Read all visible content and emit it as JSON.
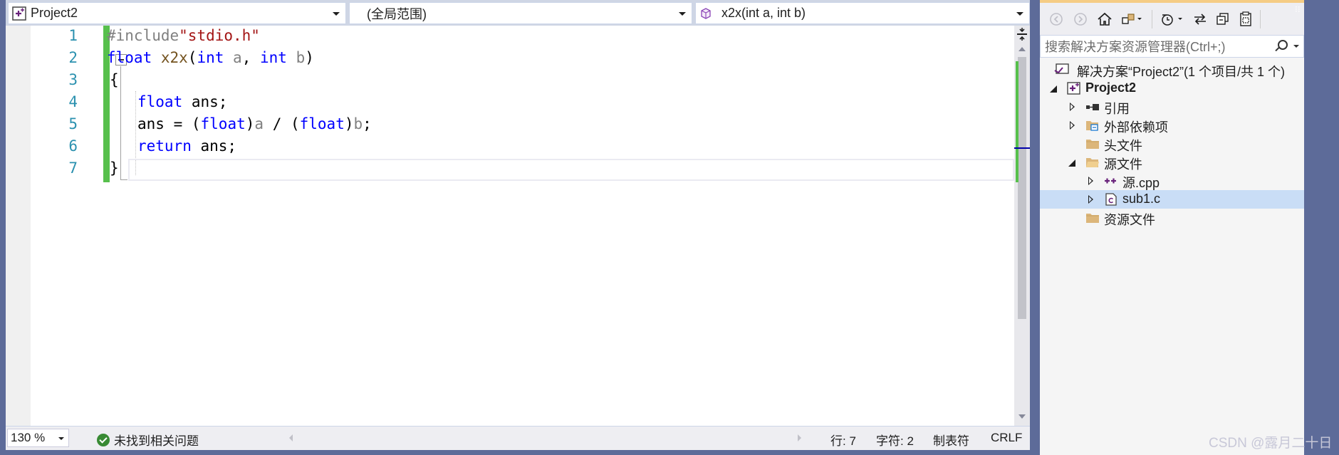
{
  "nav": {
    "project": "Project2",
    "scope": "(全局范围)",
    "member": "x2x(int a, int b)"
  },
  "editor": {
    "line_numbers": [
      "1",
      "2",
      "3",
      "4",
      "5",
      "6",
      "7"
    ],
    "lines": {
      "l1_pp": "#include",
      "l1_str": "\"stdio.h\"",
      "l2_kw1": "float",
      "l2_fn": " x2x",
      "l2_p1": "(",
      "l2_kw2": "int",
      "l2_a": " a",
      "l2_comma": ", ",
      "l2_kw3": "int",
      "l2_b": " b",
      "l2_p2": ")",
      "l3": "{",
      "l4_kw": "float",
      "l4_rest": " ans;",
      "l5_a": "ans = (",
      "l5_kw1": "float",
      "l5_b": ")",
      "l5_pa": "a",
      "l5_c": " / (",
      "l5_kw2": "float",
      "l5_d": ")",
      "l5_pb": "b",
      "l5_e": ";",
      "l6_kw": "return",
      "l6_rest": " ans;",
      "l7": "}"
    }
  },
  "status": {
    "zoom": "130 %",
    "issues": "未找到相关问题",
    "line": "行: 7",
    "col": "字符: 2",
    "tabs": "制表符",
    "eol": "CRLF"
  },
  "solution_explorer": {
    "search_placeholder": "搜索解决方案资源管理器(Ctrl+;)",
    "items": [
      {
        "label": "解决方案“Project2”(1 个项目/共 1 个)"
      },
      {
        "label": "Project2"
      },
      {
        "label": "引用"
      },
      {
        "label": "外部依赖项"
      },
      {
        "label": "头文件"
      },
      {
        "label": "源文件"
      },
      {
        "label": "源.cpp"
      },
      {
        "label": "sub1.c"
      },
      {
        "label": "资源文件"
      }
    ]
  },
  "watermark": "CSDN @露月二十日",
  "colors": {
    "keyword": "#0000ff",
    "string": "#a31515",
    "line_number": "#2b91af",
    "change_bar": "#57c04c",
    "selection": "#c9ddf6",
    "frame": "#5d6b99"
  }
}
